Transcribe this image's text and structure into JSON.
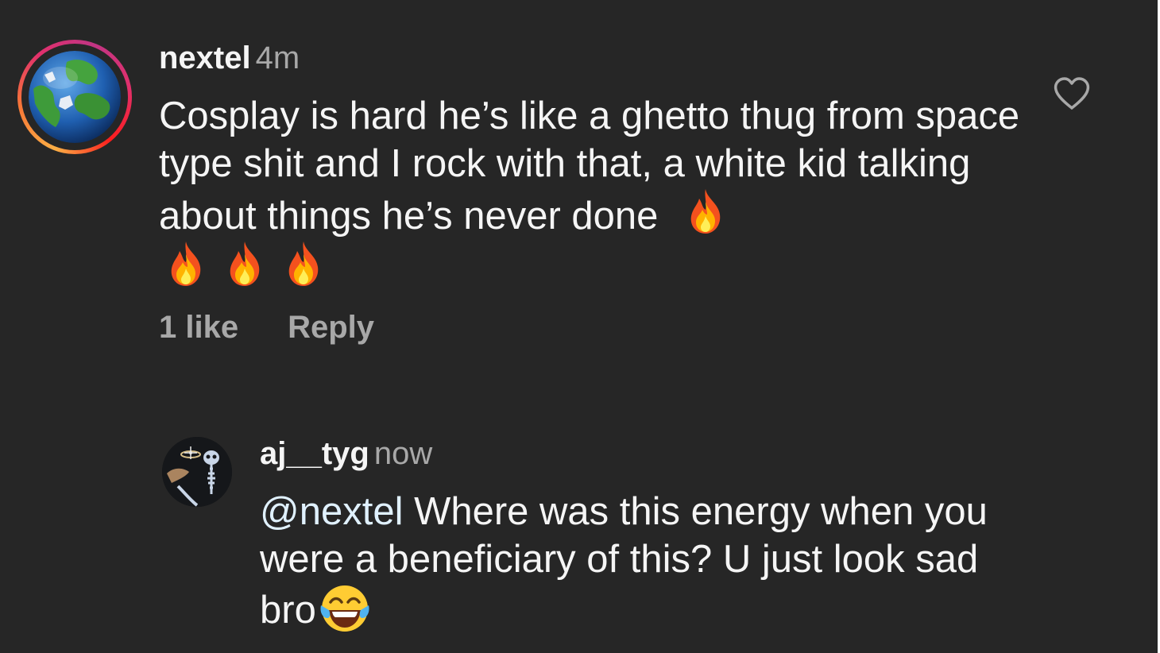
{
  "comment": {
    "username": "nextel",
    "time": "4m",
    "text": "Cosplay is hard he’s like a ghetto thug from space type shit and I rock with that, a white kid talking about things he’s never done",
    "emoji_icon": "fire-emoji",
    "emoji_count": 4,
    "likes_label": "1 like",
    "reply_label": "Reply",
    "avatar_icon": "globe-avatar",
    "like_icon": "heart-outline-icon"
  },
  "reply": {
    "username": "aj__tyg",
    "time": "now",
    "mention": "@nextel",
    "text": " Where was this energy when you were a beneficiary of this? U just look sad bro",
    "emoji_icon": "face-with-tears-of-joy-emoji",
    "avatar_icon": "skeleton-avatar"
  },
  "colors": {
    "background": "#262626",
    "primary_text": "#f5f5f5",
    "secondary_text": "#a8a8a8",
    "mention": "#e0f1ff"
  }
}
